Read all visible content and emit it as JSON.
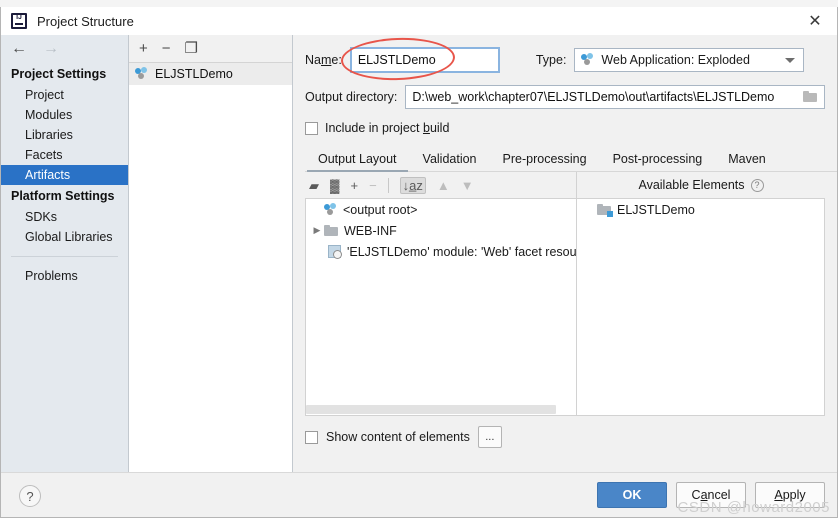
{
  "window": {
    "title": "Project Structure",
    "app_icon": "intellij-idea-logo",
    "close_label": "✕"
  },
  "nav": {
    "back_arrow": "←",
    "forward_arrow": "→"
  },
  "sidebar": {
    "groups": [
      {
        "label": "Project Settings",
        "items": [
          {
            "label": "Project",
            "selected": false
          },
          {
            "label": "Modules",
            "selected": false
          },
          {
            "label": "Libraries",
            "selected": false
          },
          {
            "label": "Facets",
            "selected": false
          },
          {
            "label": "Artifacts",
            "selected": true
          }
        ]
      },
      {
        "label": "Platform Settings",
        "items": [
          {
            "label": "SDKs",
            "selected": false
          },
          {
            "label": "Global Libraries",
            "selected": false
          }
        ]
      }
    ],
    "problems_label": "Problems"
  },
  "artifacts_panel": {
    "toolbar": {
      "add_label": "+",
      "remove_label": "−",
      "copy_label": "❐"
    },
    "items": [
      {
        "label": "ELJSTLDemo",
        "icon": "artifact-icon",
        "selected": true
      }
    ]
  },
  "details": {
    "name_label": "Na",
    "name_label_underlined": "m",
    "name_label_rest": "e:",
    "name_value": "ELJSTLDemo",
    "type_label": "Type:",
    "type_value": "Web Application: Exploded",
    "type_icon": "artifact-icon",
    "output_dir_label": "Output directory:",
    "output_dir_value": "D:\\web_work\\chapter07\\ELJSTLDemo\\out\\artifacts\\ELJSTLDemo",
    "browse_icon": "folder-icon",
    "include_in_build_label_a": "Include in project ",
    "include_in_build_label_u": "b",
    "include_in_build_label_b": "uild",
    "include_in_build_checked": false
  },
  "tabs": [
    {
      "label": "Output Layout",
      "active": true
    },
    {
      "label": "Validation",
      "active": false
    },
    {
      "label": "Pre-processing",
      "active": false
    },
    {
      "label": "Post-processing",
      "active": false
    },
    {
      "label": "Maven",
      "active": false
    }
  ],
  "layout_toolbar": {
    "buttons": [
      {
        "name": "add-directory-icon",
        "glyph": "▰",
        "state": "enabled"
      },
      {
        "name": "add-archive-icon",
        "glyph": "▓",
        "state": "enabled"
      },
      {
        "name": "add-element-icon",
        "glyph": "+",
        "state": "enabled"
      },
      {
        "name": "remove-element-icon",
        "glyph": "−",
        "state": "disabled"
      },
      {
        "name": "sort-alphabetically-icon",
        "glyph": "↓a̲z",
        "state": "pressed"
      },
      {
        "name": "move-up-icon",
        "glyph": "▲",
        "state": "disabled"
      },
      {
        "name": "move-down-icon",
        "glyph": "▼",
        "state": "disabled"
      }
    ]
  },
  "output_tree": {
    "rows": [
      {
        "indent": 0,
        "twisty": "",
        "icon": "artifact-icon",
        "label": "<output root>"
      },
      {
        "indent": 0,
        "twisty": "▶",
        "icon": "folder-icon",
        "label": "WEB-INF"
      },
      {
        "indent": 1,
        "twisty": "",
        "icon": "facet-icon",
        "label": "'ELJSTLDemo' module: 'Web' facet resources"
      }
    ],
    "scrollbar_present": true
  },
  "available_elements": {
    "header": "Available Elements",
    "help_icon": "help-icon",
    "help_glyph": "?",
    "rows": [
      {
        "icon": "module-folder-icon",
        "label": "ELJSTLDemo"
      }
    ]
  },
  "bottom_options": {
    "show_content_label": "Show content of elements",
    "show_content_checked": false,
    "more_button_label": "..."
  },
  "footer": {
    "help_glyph": "?",
    "ok_label": "OK",
    "cancel_label_a": "C",
    "cancel_label_u": "a",
    "cancel_label_b": "ncel",
    "apply_label_a": "",
    "apply_label_u": "A",
    "apply_label_b": "pply"
  },
  "annotation": {
    "type": "red-ellipse-highlight",
    "target": "name-input",
    "color": "#e8554a"
  },
  "watermark": {
    "text": "CSDN @howard2005"
  },
  "colors": {
    "accent_blue": "#2a72c6",
    "ok_button": "#4a86c8",
    "sidebar_bg": "#e4e9ee",
    "dialog_bg": "#f1f1f1",
    "annotation_red": "#e8554a"
  }
}
